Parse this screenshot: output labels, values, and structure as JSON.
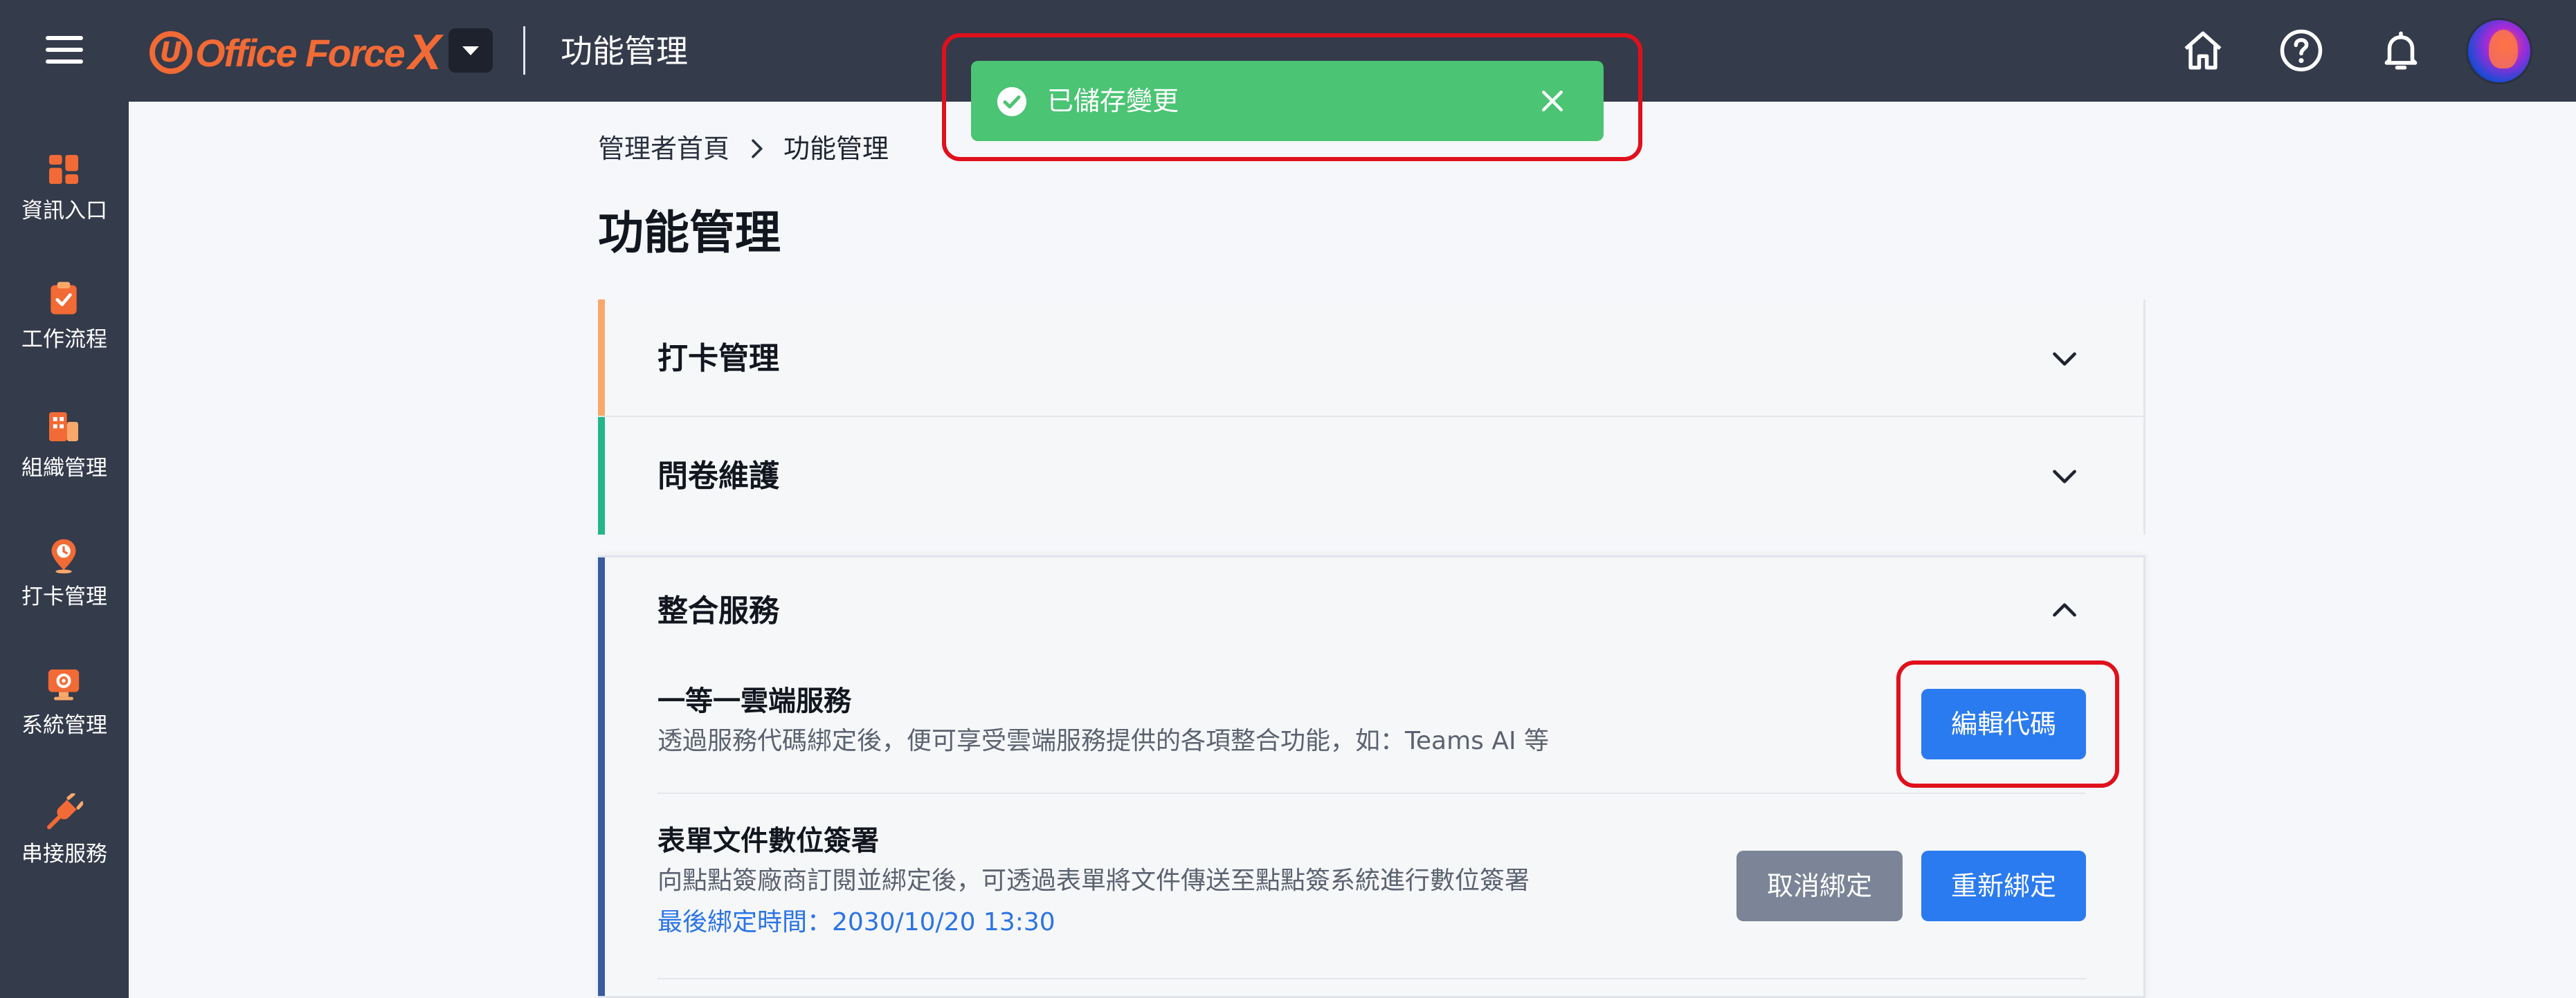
{
  "app": {
    "logo_text": "Office Force",
    "logo_mark": "U",
    "logo_x": "X",
    "page_title_top": "功能管理"
  },
  "topbar_icons": [
    "home-icon",
    "help-icon",
    "bell-icon",
    "avatar"
  ],
  "sidebar": {
    "items": [
      {
        "label": "資訊入口",
        "icon": "dashboard-icon"
      },
      {
        "label": "工作流程",
        "icon": "clipboard-check-icon"
      },
      {
        "label": "組織管理",
        "icon": "building-icon"
      },
      {
        "label": "打卡管理",
        "icon": "location-clock-icon"
      },
      {
        "label": "系統管理",
        "icon": "monitor-gear-icon"
      },
      {
        "label": "串接服務",
        "icon": "plug-icon"
      }
    ]
  },
  "breadcrumb": {
    "home": "管理者首頁",
    "current": "功能管理"
  },
  "main": {
    "title": "功能管理",
    "panels": [
      {
        "title": "打卡管理",
        "accent": "#f9a86a",
        "expanded": false
      },
      {
        "title": "問卷維護",
        "accent": "#24b58a",
        "expanded": false
      },
      {
        "title": "整合服務",
        "accent": "#3a5c9c",
        "expanded": true
      }
    ],
    "services": [
      {
        "title": "一等一雲端服務",
        "desc": "透過服務代碼綁定後，便可享受雲端服務提供的各項整合功能，如：Teams AI 等",
        "button": "編輯代碼"
      },
      {
        "title": "表單文件數位簽署",
        "desc": "向點點簽廠商訂閱並綁定後，可透過表單將文件傳送至點點簽系統進行數位簽署",
        "time": "最後綁定時間：2030/10/20 13:30",
        "button_unbind": "取消綁定",
        "button_rebind": "重新綁定"
      }
    ]
  },
  "toast": {
    "message": "已儲存變更",
    "type": "success",
    "color": "#4bc474"
  },
  "colors": {
    "topbar": "#343b4b",
    "primary": "#2b7bf0",
    "brand": "#f26a35",
    "highlight": "#e0101c"
  }
}
